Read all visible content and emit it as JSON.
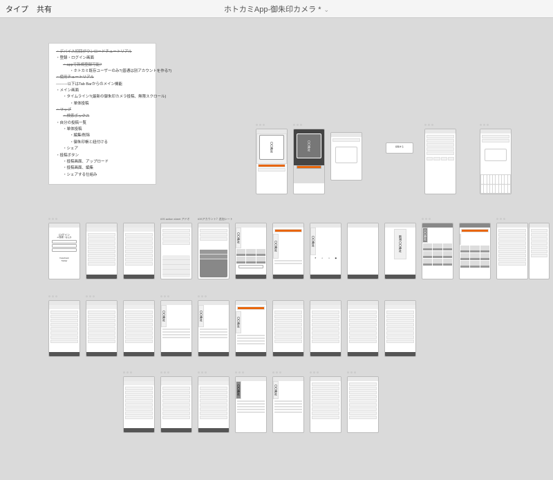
{
  "topbar": {
    "left1": "タイプ",
    "left2": "共有",
    "title": "ホトカミApp-御朱印カメラ *"
  },
  "note": {
    "l1": "・デバイス初回ダウンロードチュートリアル",
    "l2": "・登録・ログイン画面",
    "l3": "・appで新規登録可能?",
    "l4": "・ホトカミ既存ユーザーのみ?(普通は別アカウントを作る?)",
    "l5": "・使用チュートリアル",
    "l6": "---------以下はTab Barからのメイン機能",
    "l7": "・メイン画面",
    "l8": "・タイムライン?(最新の御朱印カメラ投稿、無限スクロール)",
    "l9": "・単体投稿",
    "l10": "・マップ",
    "l11": "・検索ボックス",
    "l12": "・自分の投稿一覧",
    "l13": "・単体投稿",
    "l14": "・編集/削除",
    "l15": "・御朱印帳と紐付ける",
    "l16": "・シェア",
    "l17": "・投稿ボタン",
    "l18": "・投稿画面、アップロード",
    "l19": "・投稿画面、編集",
    "l20": "・シェアする仕組み"
  },
  "labels": {
    "actionsheet": "iOS action sheet アドオ",
    "accountsheet": "iOSアカウント？追加シート",
    "login": "ログイン",
    "loginSub": "or登録？なんか",
    "facebook": "Facebook",
    "twitter": "Twitter",
    "shrine": "〇〇神社",
    "shrine2": "新潟 〇〇神社",
    "post": "投稿する"
  },
  "artboards": [
    {
      "id": "camera1"
    },
    {
      "id": "camera2"
    },
    {
      "id": "dialog1"
    },
    {
      "id": "post-select"
    },
    {
      "id": "form1"
    },
    {
      "id": "keyboard1"
    },
    {
      "id": "login"
    },
    {
      "id": "list1"
    },
    {
      "id": "list2"
    },
    {
      "id": "sheet1"
    },
    {
      "id": "sheet2"
    },
    {
      "id": "timeline1"
    },
    {
      "id": "detail1"
    },
    {
      "id": "detail2"
    },
    {
      "id": "detail3"
    },
    {
      "id": "detail4"
    },
    {
      "id": "filter"
    },
    {
      "id": "grid1"
    },
    {
      "id": "grid2"
    },
    {
      "id": "grid3"
    },
    {
      "id": "form-list"
    },
    {
      "id": "form-list2"
    }
  ]
}
